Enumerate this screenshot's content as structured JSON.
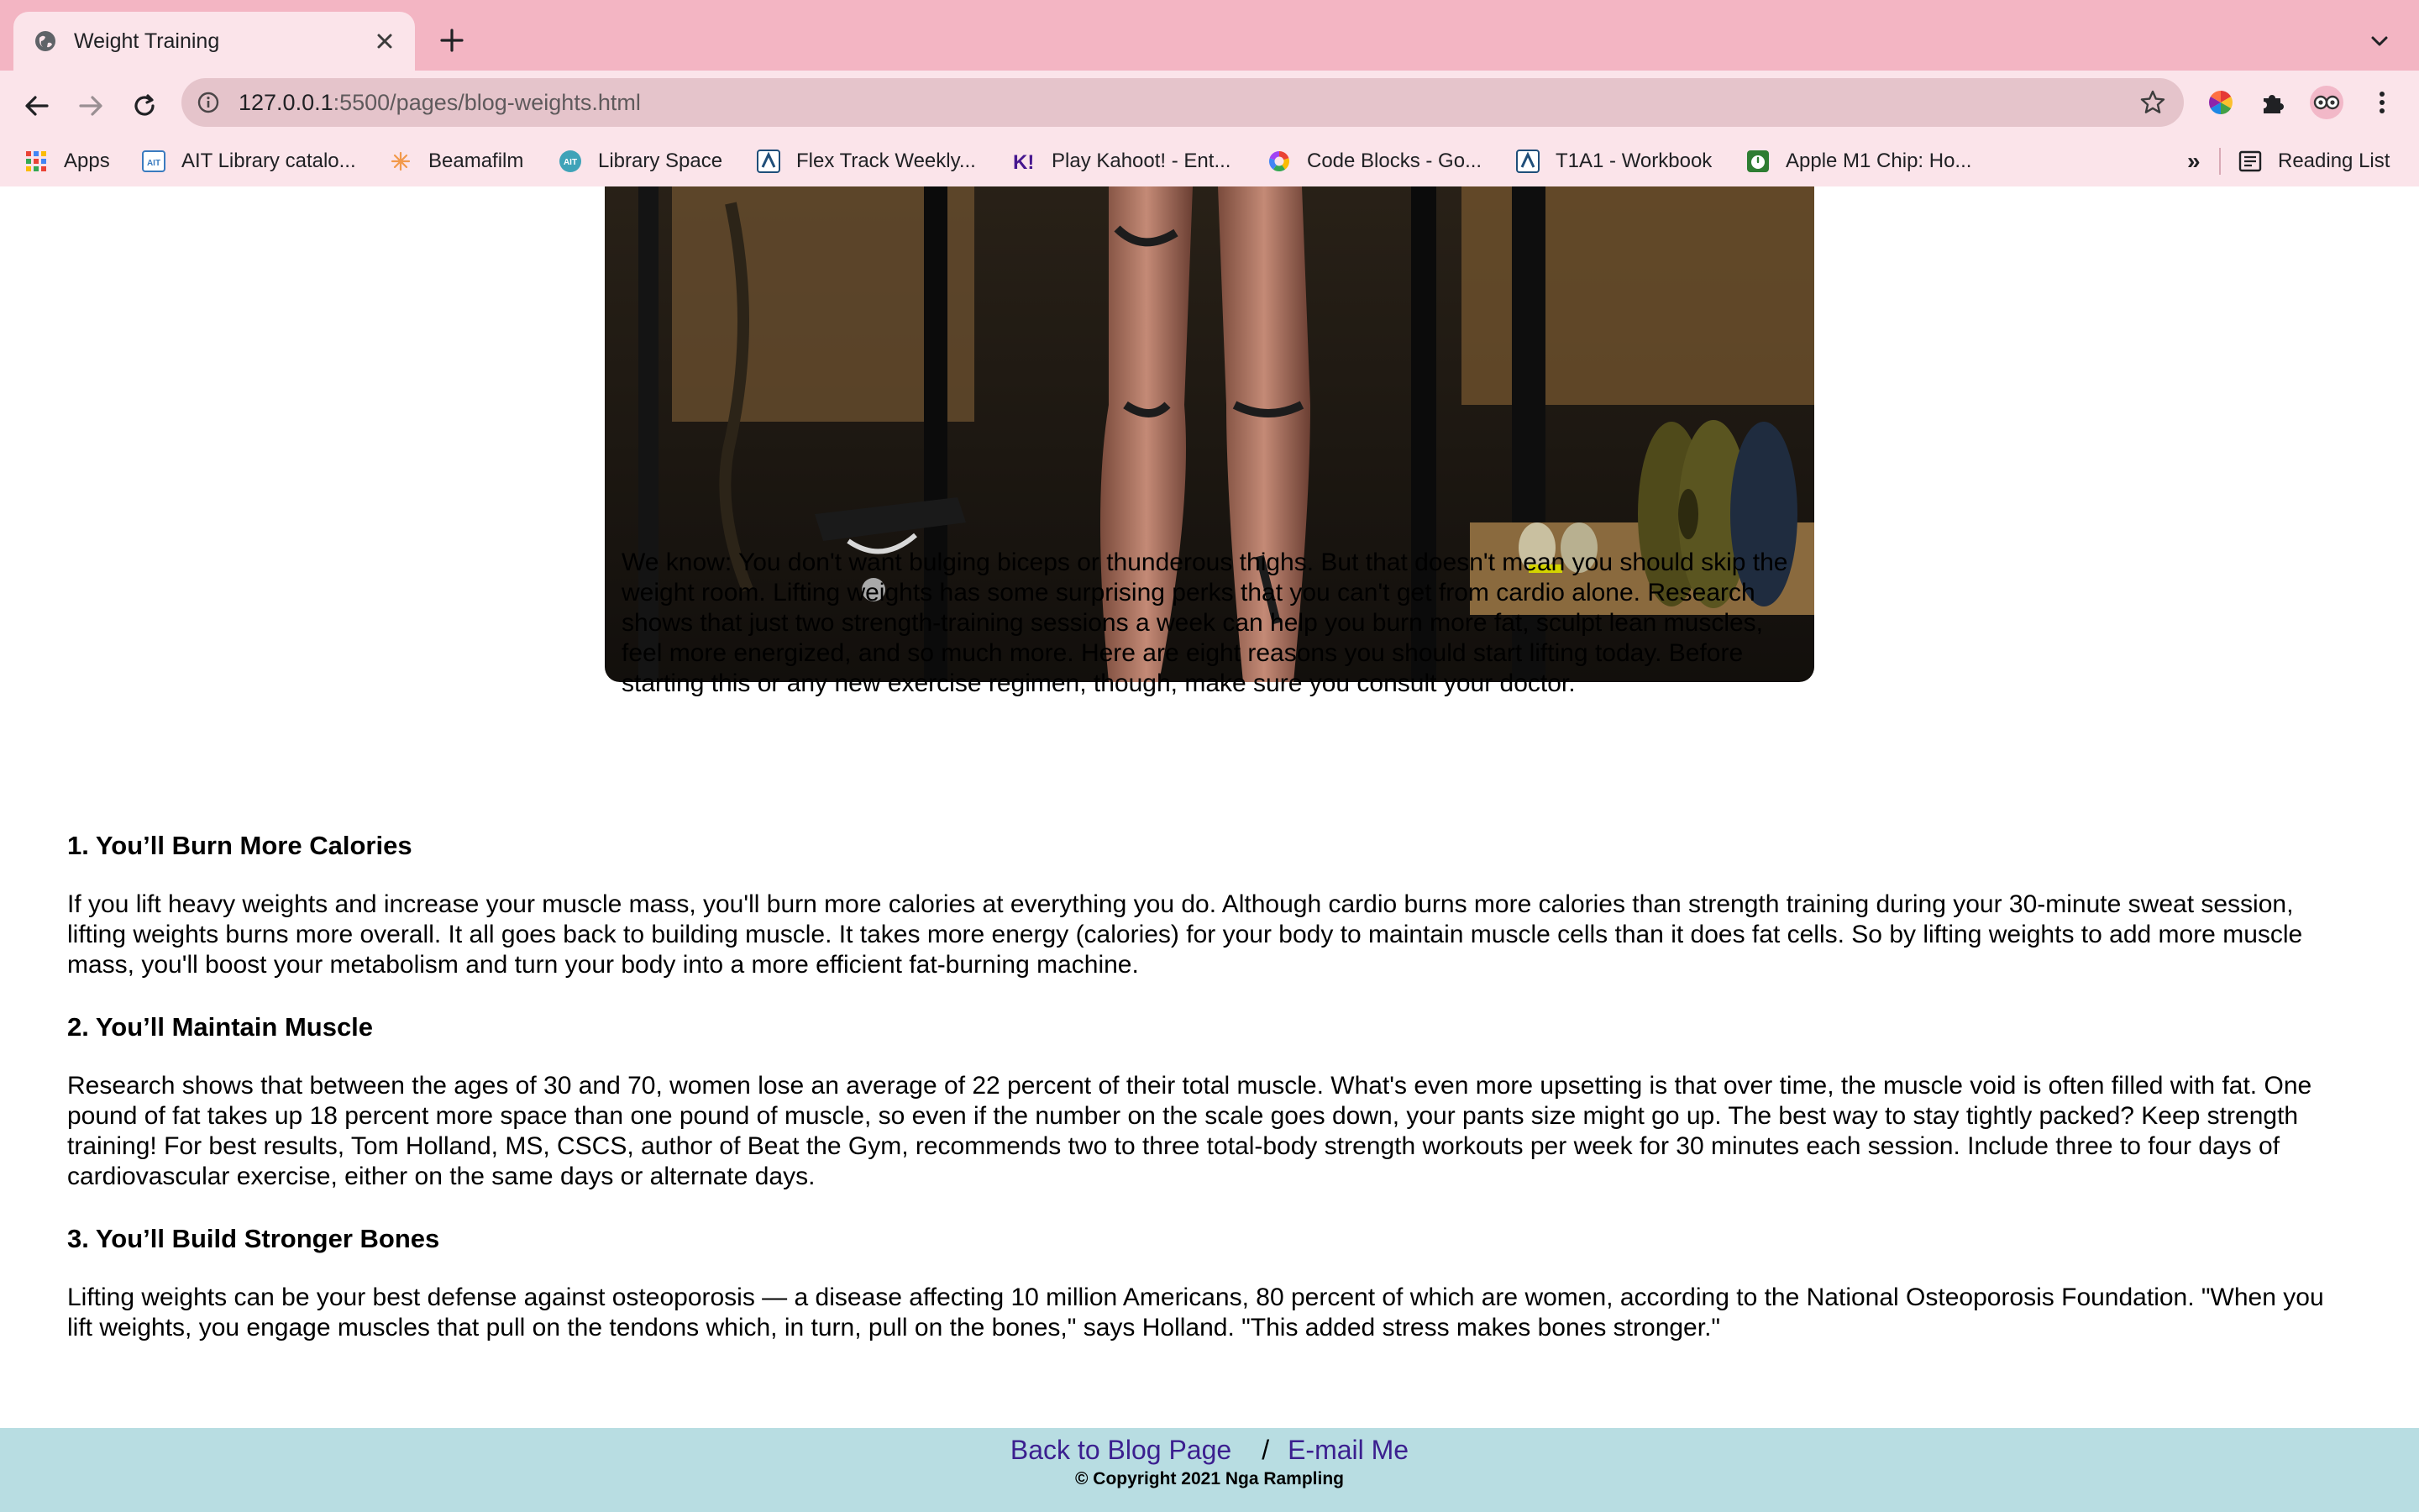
{
  "tab": {
    "title": "Weight Training"
  },
  "address_bar": {
    "host": "127.0.0.1",
    "path": ":5500/pages/blog-weights.html"
  },
  "bookmarks": [
    {
      "label": "Apps",
      "icon": "apps-grid-icon"
    },
    {
      "label": "AIT Library catalo...",
      "icon": "ait-icon"
    },
    {
      "label": "Beamafilm",
      "icon": "beamafilm-icon"
    },
    {
      "label": "Library Space",
      "icon": "ait-circle-icon"
    },
    {
      "label": "Flex Track Weekly...",
      "icon": "canvas-icon"
    },
    {
      "label": "Play Kahoot! - Ent...",
      "icon": "kahoot-icon"
    },
    {
      "label": "Code Blocks - Go...",
      "icon": "google-icon"
    },
    {
      "label": "T1A1 - Workbook",
      "icon": "canvas-icon"
    },
    {
      "label": "Apple M1 Chip: Ho...",
      "icon": "stopwatch-icon"
    }
  ],
  "bookmarks_overflow": "»",
  "reading_list": "Reading List",
  "intro": "We know: You don't want bulging biceps or thunderous thighs. But that doesn't mean you should skip the weight room. Lifting weights has some surprising perks that you can't get from cardio alone. Research shows that just two strength-training sessions a week can help you burn more fat, sculpt lean muscles, feel more energized, and so much more. Here are eight reasons you should start lifting today. Before starting this or any new exercise regimen, though, make sure you consult your doctor.",
  "sections": [
    {
      "heading": "1. You’ll Burn More Calories",
      "body": "If you lift heavy weights and increase your muscle mass, you'll burn more calories at everything you do. Although cardio burns more calories than strength training during your 30-minute sweat session, lifting weights burns more overall. It all goes back to building muscle. It takes more energy (calories) for your body to maintain muscle cells than it does fat cells. So by lifting weights to add more muscle mass, you'll boost your metabolism and turn your body into a more efficient fat-burning machine."
    },
    {
      "heading": "2. You’ll Maintain Muscle",
      "body": "Research shows that between the ages of 30 and 70, women lose an average of 22 percent of their total muscle. What's even more upsetting is that over time, the muscle void is often filled with fat. One pound of fat takes up 18 percent more space than one pound of muscle, so even if the number on the scale goes down, your pants size might go up. The best way to stay tightly packed? Keep strength training! For best results, Tom Holland, MS, CSCS, author of Beat the Gym, recommends two to three total-body strength workouts per week for 30 minutes each session. Include three to four days of cardiovascular exercise, either on the same days or alternate days."
    },
    {
      "heading": "3. You’ll Build Stronger Bones",
      "body": "Lifting weights can be your best defense against osteoporosis — a disease affecting 10 million Americans, 80 percent of which are women, according to the National Osteoporosis Foundation. \"When you lift weights, you engage muscles that pull on the tendons which, in turn, pull on the bones,\" says Holland. \"This added stress makes bones stronger.\""
    }
  ],
  "footer": {
    "back_link": "Back to Blog Page",
    "separator": "/",
    "email_link": "E-mail Me",
    "copyright": "© Copyright 2021 Nga Rampling"
  },
  "colors": {
    "tabbar": "#f3b5c3",
    "toolbar": "#fbe4ea",
    "footer": "#b8dde2",
    "link": "#3b1f8f"
  }
}
